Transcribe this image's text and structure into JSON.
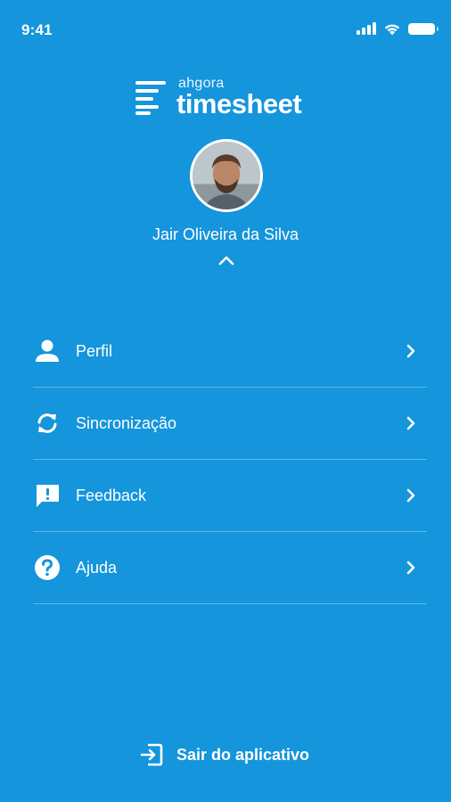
{
  "status_bar": {
    "time": "9:41",
    "icons": [
      "cellular-signal-icon",
      "wifi-icon",
      "battery-icon"
    ]
  },
  "logo": {
    "small_text": "ahgora",
    "big_text": "timesheet"
  },
  "user": {
    "name": "Jair Oliveira da Silva"
  },
  "menu": {
    "items": [
      {
        "label": "Perfil",
        "icon": "person-icon"
      },
      {
        "label": "Sincronização",
        "icon": "sync-icon"
      },
      {
        "label": "Feedback",
        "icon": "feedback-icon"
      },
      {
        "label": "Ajuda",
        "icon": "help-icon"
      }
    ]
  },
  "logout": {
    "label": "Sair do aplicativo",
    "icon": "exit-icon"
  },
  "colors": {
    "background": "#1495dc",
    "foreground": "#ffffff"
  }
}
